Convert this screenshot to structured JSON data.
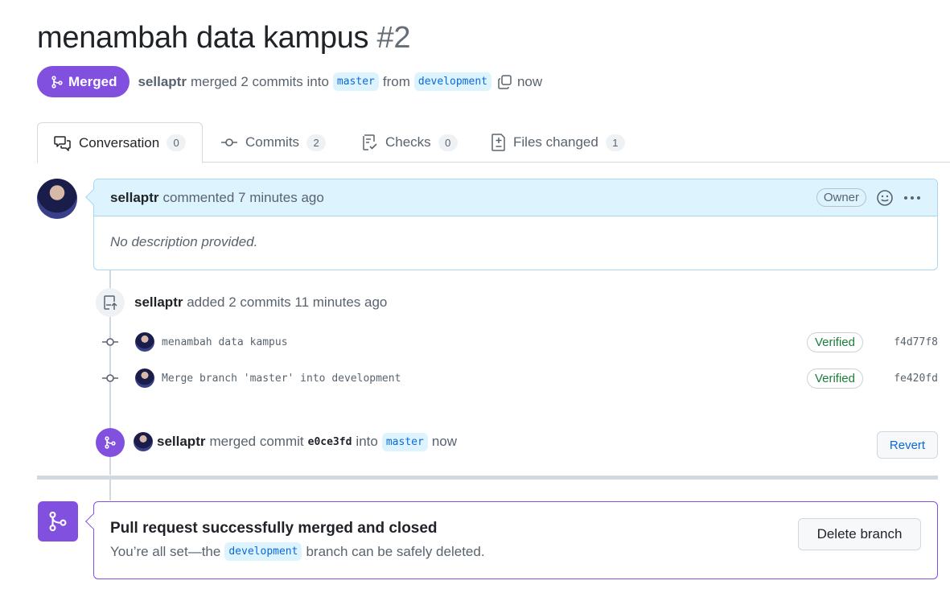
{
  "pr": {
    "title": "menambah data kampus",
    "number": "#2",
    "status": "Merged",
    "author": "sellaptr",
    "merged_text": "merged 2 commits into",
    "base_branch": "master",
    "from_text": "from",
    "head_branch": "development",
    "time": "now"
  },
  "tabs": [
    {
      "label": "Conversation",
      "count": "0",
      "icon": "comment-discussion-icon"
    },
    {
      "label": "Commits",
      "count": "2",
      "icon": "git-commit-icon"
    },
    {
      "label": "Checks",
      "count": "0",
      "icon": "checklist-icon"
    },
    {
      "label": "Files changed",
      "count": "1",
      "icon": "file-diff-icon"
    }
  ],
  "comment": {
    "author": "sellaptr",
    "action": "commented 7 minutes ago",
    "role": "Owner",
    "body": "No description provided."
  },
  "commits_event": {
    "author": "sellaptr",
    "action": "added 2 commits 11 minutes ago",
    "commits": [
      {
        "message": "menambah data kampus",
        "badge": "Verified",
        "sha": "f4d77f8"
      },
      {
        "message": "Merge branch 'master' into development",
        "badge": "Verified",
        "sha": "fe420fd"
      }
    ]
  },
  "merge_event": {
    "author": "sellaptr",
    "action": "merged commit",
    "sha": "e0ce3fd",
    "into_text": "into",
    "branch": "master",
    "time": "now",
    "revert_label": "Revert"
  },
  "merged_box": {
    "title": "Pull request successfully merged and closed",
    "sub_before": "You’re all set—the",
    "branch": "development",
    "sub_after": "branch can be safely deleted.",
    "delete_label": "Delete branch"
  },
  "colors": {
    "merged_purple": "#8250df",
    "branch_bg": "#ddf4ff",
    "verified_green": "#1a7f37"
  }
}
